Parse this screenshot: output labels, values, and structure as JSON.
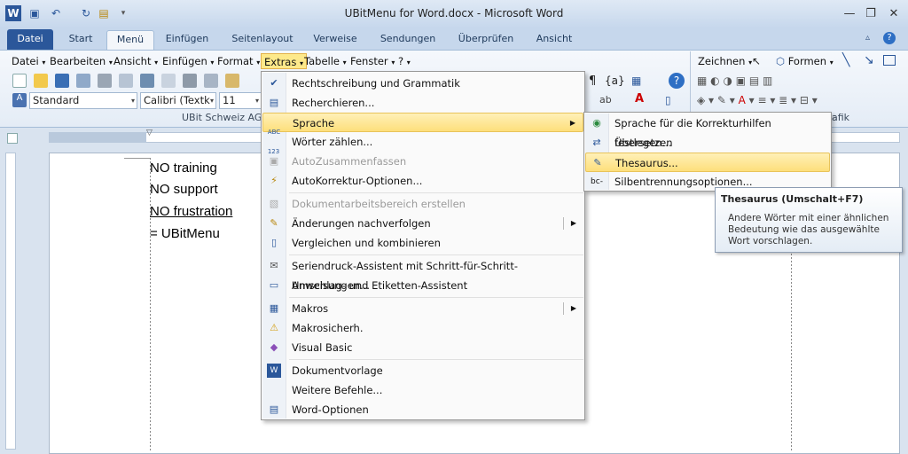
{
  "window": {
    "title": "UBitMenu for Word.docx  -  Microsoft Word"
  },
  "ribbon_tabs": [
    "Datei",
    "Start",
    "Menü",
    "Einfügen",
    "Seitenlayout",
    "Verweise",
    "Sendungen",
    "Überprüfen",
    "Ansicht"
  ],
  "menubar": [
    "Datei",
    "Bearbeiten",
    "Ansicht",
    "Einfügen",
    "Format",
    "Extras",
    "Tabelle",
    "Fenster",
    "?"
  ],
  "menubar_right": {
    "zeichnen": "Zeichnen",
    "formen": "Formen"
  },
  "toolbar": {
    "style": "Standard",
    "font": "Calibri (Textk",
    "size": "11",
    "group_label": "UBit Schweiz AG",
    "group_label_right": "afik"
  },
  "document": {
    "lines": [
      "NO training",
      "NO support",
      "NO frustration",
      "= UBitMenu"
    ]
  },
  "extras_menu": {
    "items": [
      {
        "label": "Rechtschreibung und Grammatik",
        "icon": "spelling-icon",
        "disabled": false
      },
      {
        "label": "Recherchieren...",
        "icon": "research-icon",
        "disabled": false
      },
      {
        "label": "Sprache",
        "icon": "",
        "disabled": false,
        "submenu": true
      },
      {
        "label": "Wörter zählen...",
        "icon": "word-count-icon",
        "disabled": false
      },
      {
        "label": "AutoZusammenfassen",
        "icon": "autosummary-icon",
        "disabled": true
      },
      {
        "label": "AutoKorrektur-Optionen...",
        "icon": "autocorrect-icon",
        "disabled": false
      },
      {
        "label": "Dokumentarbeitsbereich erstellen",
        "icon": "workspace-icon",
        "disabled": true
      },
      {
        "label": "Änderungen nachverfolgen",
        "icon": "track-changes-icon",
        "disabled": false,
        "submenu": true
      },
      {
        "label": "Vergleichen und kombinieren",
        "icon": "compare-icon",
        "disabled": false
      },
      {
        "label": "Seriendruck-Assistent mit Schritt-für-Schritt-Anweisungen...",
        "icon": "mail-merge-icon",
        "disabled": false
      },
      {
        "label": "Umschlag- und Etiketten-Assistent",
        "icon": "envelope-icon",
        "disabled": false
      },
      {
        "label": "Makros",
        "icon": "macros-icon",
        "disabled": false,
        "submenu": true
      },
      {
        "label": "Makrosicherh.",
        "icon": "warning-icon",
        "disabled": false
      },
      {
        "label": "Visual Basic",
        "icon": "visual-basic-icon",
        "disabled": false
      },
      {
        "label": "Dokumentvorlage",
        "icon": "template-icon",
        "disabled": false
      },
      {
        "label": "Weitere Befehle...",
        "icon": "",
        "disabled": false
      },
      {
        "label": "Word-Optionen",
        "icon": "options-icon",
        "disabled": false
      }
    ]
  },
  "sprache_menu": {
    "items": [
      {
        "label": "Sprache für die Korrekturhilfen festlegen...",
        "icon": "language-icon"
      },
      {
        "label": "Übersetzen",
        "icon": "translate-icon"
      },
      {
        "label": "Thesaurus...",
        "icon": "thesaurus-icon"
      },
      {
        "label": "Silbentrennungsoptionen...",
        "icon": "hyphenation-icon"
      }
    ]
  },
  "tooltip": {
    "title": "Thesaurus (Umschalt+F7)",
    "body": "Andere Wörter mit einer ähnlichen Bedeutung wie das ausgewählte Wort vorschlagen."
  },
  "colors": {
    "accent": "#2b579a",
    "highlight": "#fddf7b"
  }
}
